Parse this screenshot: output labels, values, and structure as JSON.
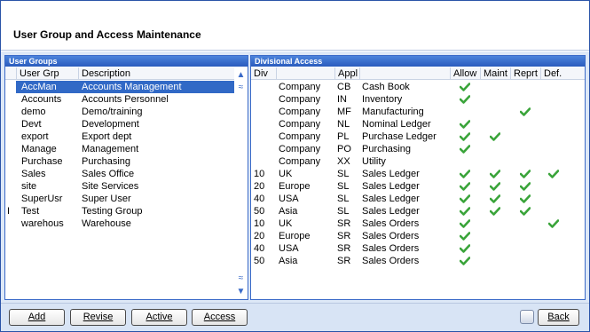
{
  "window": {
    "title": "User Group and Access Maintenance"
  },
  "user_groups": {
    "panel_title": "User Groups",
    "columns": {
      "user_grp": "User Grp",
      "description": "Description"
    },
    "rows": [
      {
        "user_grp": "AccMan",
        "description": "Accounts Management",
        "selected": true
      },
      {
        "user_grp": "Accounts",
        "description": "Accounts Personnel"
      },
      {
        "user_grp": "demo",
        "description": "Demo/training"
      },
      {
        "user_grp": "Devt",
        "description": "Development"
      },
      {
        "user_grp": "export",
        "description": "Export dept"
      },
      {
        "user_grp": "Manage",
        "description": "Management"
      },
      {
        "user_grp": "Purchase",
        "description": "Purchasing"
      },
      {
        "user_grp": "Sales",
        "description": "Sales Office"
      },
      {
        "user_grp": "site",
        "description": "Site Services"
      },
      {
        "user_grp": "SuperUsr",
        "description": "Super User"
      },
      {
        "user_grp": "Test",
        "description": "Testing Group",
        "marker": "I"
      },
      {
        "user_grp": "warehous",
        "description": "Warehouse"
      }
    ]
  },
  "divisional_access": {
    "panel_title": "Divisional Access",
    "columns": {
      "div": "Div",
      "appl": "Appl",
      "allow": "Allow",
      "maint": "Maint",
      "reprt": "Reprt",
      "def": "Def."
    },
    "rows": [
      {
        "div": "",
        "region": "Company",
        "appl": "CB",
        "name": "Cash Book",
        "allow": true,
        "maint": false,
        "reprt": false,
        "def": false
      },
      {
        "div": "",
        "region": "Company",
        "appl": "IN",
        "name": "Inventory",
        "allow": true,
        "maint": false,
        "reprt": false,
        "def": false
      },
      {
        "div": "",
        "region": "Company",
        "appl": "MF",
        "name": "Manufacturing",
        "allow": false,
        "maint": false,
        "reprt": true,
        "def": false
      },
      {
        "div": "",
        "region": "Company",
        "appl": "NL",
        "name": "Nominal Ledger",
        "allow": true,
        "maint": false,
        "reprt": false,
        "def": false
      },
      {
        "div": "",
        "region": "Company",
        "appl": "PL",
        "name": "Purchase Ledger",
        "allow": true,
        "maint": true,
        "reprt": false,
        "def": false
      },
      {
        "div": "",
        "region": "Company",
        "appl": "PO",
        "name": "Purchasing",
        "allow": true,
        "maint": false,
        "reprt": false,
        "def": false
      },
      {
        "div": "",
        "region": "Company",
        "appl": "XX",
        "name": "Utility",
        "allow": false,
        "maint": false,
        "reprt": false,
        "def": false
      },
      {
        "div": "10",
        "region": "UK",
        "appl": "SL",
        "name": "Sales Ledger",
        "allow": true,
        "maint": true,
        "reprt": true,
        "def": true
      },
      {
        "div": "20",
        "region": "Europe",
        "appl": "SL",
        "name": "Sales Ledger",
        "allow": true,
        "maint": true,
        "reprt": true,
        "def": false
      },
      {
        "div": "40",
        "region": "USA",
        "appl": "SL",
        "name": "Sales Ledger",
        "allow": true,
        "maint": true,
        "reprt": true,
        "def": false
      },
      {
        "div": "50",
        "region": "Asia",
        "appl": "SL",
        "name": "Sales Ledger",
        "allow": true,
        "maint": true,
        "reprt": true,
        "def": false
      },
      {
        "div": "10",
        "region": "UK",
        "appl": "SR",
        "name": "Sales Orders",
        "allow": true,
        "maint": false,
        "reprt": false,
        "def": true
      },
      {
        "div": "20",
        "region": "Europe",
        "appl": "SR",
        "name": "Sales Orders",
        "allow": true,
        "maint": false,
        "reprt": false,
        "def": false
      },
      {
        "div": "40",
        "region": "USA",
        "appl": "SR",
        "name": "Sales Orders",
        "allow": true,
        "maint": false,
        "reprt": false,
        "def": false
      },
      {
        "div": "50",
        "region": "Asia",
        "appl": "SR",
        "name": "Sales Orders",
        "allow": true,
        "maint": false,
        "reprt": false,
        "def": false
      }
    ]
  },
  "buttons": {
    "add": "Add",
    "revise": "Revise",
    "active": "Active",
    "access": "Access",
    "back": "Back"
  },
  "icons": {
    "check": "check-icon",
    "scroll_up": "scroll-up-icon",
    "scroll_down": "scroll-down-icon",
    "help": "help-icon"
  },
  "colors": {
    "selection": "#3169c6",
    "check": "#3aa43a",
    "panel_header": "#2a5bbd",
    "frame": "#dde8f7"
  }
}
